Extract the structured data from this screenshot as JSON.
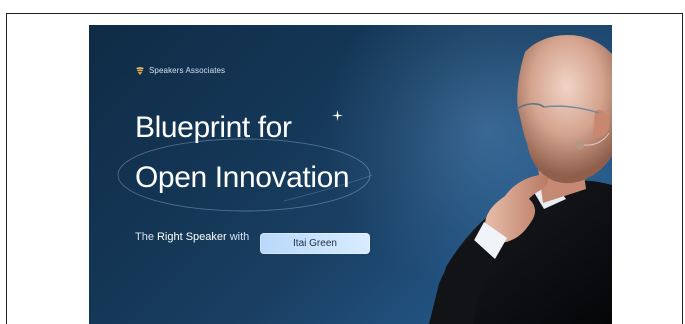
{
  "banner": {
    "brand_name": "Speakers Associates",
    "title_line_1": "Blueprint for",
    "title_line_2": "Open Innovation",
    "subtitle_prefix": "The",
    "subtitle_emphasis": "Right Speaker",
    "subtitle_suffix": "with",
    "speaker_name": "Itai Green"
  },
  "colors": {
    "background": "#143756",
    "title": "#ffffff",
    "pill_background": "#cfe4fb",
    "pill_text": "#1f2f44"
  },
  "icons": {
    "brand": "speakers-associates-logo-icon",
    "decoration": "sparkle-icon"
  }
}
